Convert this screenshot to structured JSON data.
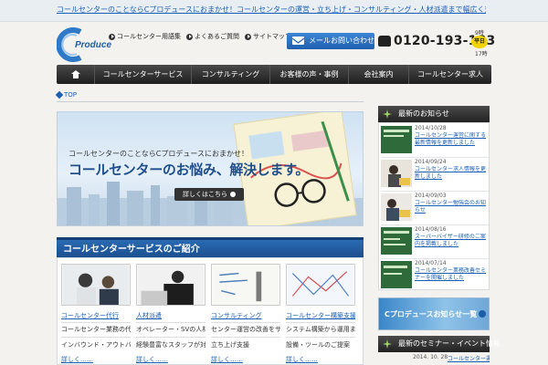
{
  "topbar": {
    "link": "コールセンターのことならCプロデュースにおまかせ！コールセンターの運営・立ち上げ・コンサルティング・人材派遣まで幅広く対応いたします"
  },
  "header": {
    "logo_text": "Produce",
    "links": [
      "コールセンター用語集",
      "よくあるご質問",
      "サイトマップ"
    ],
    "mail_button": "メールお問い合わせ",
    "phone": "0120-193-183",
    "hours_open": "9時",
    "hours_badge": "平日",
    "hours_close": "17時"
  },
  "nav": {
    "items": [
      "コールセンターサービス",
      "コンサルティング",
      "お客様の声・事例",
      "会社案内",
      "コールセンター求人"
    ]
  },
  "breadcrumb": "TOP",
  "hero": {
    "subtitle": "コールセンターのことならCプロデュースにおまかせ！",
    "title": "コールセンターのお悩み、解決します。",
    "button": "詳しくはこちら"
  },
  "services": {
    "title": "コールセンターサービスのご紹介",
    "cards": [
      {
        "link": "コールセンター代行",
        "lines": [
          "コールセンター業務の代行サービスです",
          "インバウンド・アウトバウンドに対応"
        ],
        "more": "詳しく……"
      },
      {
        "link": "人材派遣",
        "lines": [
          "オペレーター・SVの人材を派遣いたします",
          "経験豊富なスタッフが対応"
        ],
        "more": "詳しく……"
      },
      {
        "link": "コンサルティング",
        "lines": [
          "センター運営の改善をサポートします",
          "立ち上げ支援"
        ],
        "more": "詳しく……"
      },
      {
        "link": "コールセンター構築支援",
        "lines": [
          "システム構築から運用まで支援します",
          "設備・ツールのご提案"
        ],
        "more": "詳しく……"
      }
    ]
  },
  "sidebar": {
    "news_title": "最新のお知らせ",
    "news": [
      {
        "date": "2014/10/28",
        "title": "コールセンター運営に関する最新情報を更新しました"
      },
      {
        "date": "2014/09/24",
        "title": "コールセンター求人情報を更新しました"
      },
      {
        "date": "2014/09/03",
        "title": "コールセンター勉強会のお知らせ"
      },
      {
        "date": "2014/08/16",
        "title": "スーパーバイザー研修のご案内を掲載しました"
      },
      {
        "date": "2014/07/14",
        "title": "コールセンター業務改善セミナーを開催しました"
      }
    ],
    "banner": "Cプロデュースお知らせ一覧",
    "seminar_title": "最新のセミナー・イベント情報",
    "seminar_date": "2014. 10. 28",
    "seminar_link": "コールセンター運営セミナー"
  },
  "colors": {
    "primary_blue": "#1f5fae",
    "nav_dark": "#2a2a2a",
    "link_blue": "#1a5fb4",
    "accent_yellow": "#f2d300"
  }
}
